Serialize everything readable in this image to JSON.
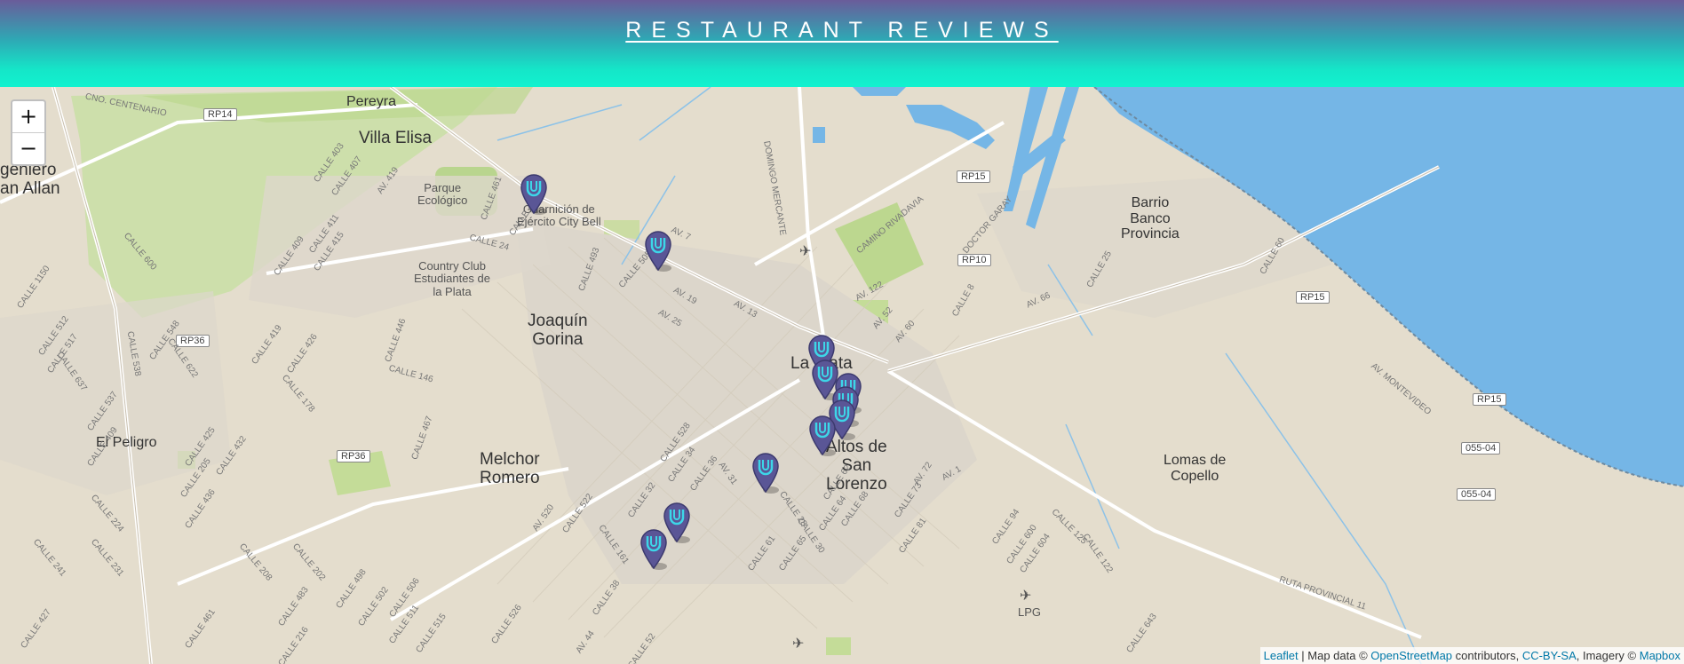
{
  "header": {
    "title": "RESTAURANT REVIEWS"
  },
  "map": {
    "zoom_in": "+",
    "zoom_out": "−",
    "attribution": {
      "leaflet": "Leaflet",
      "sep1": " | Map data © ",
      "osm": "OpenStreetMap",
      "contrib": " contributors, ",
      "license": "CC-BY-SA",
      "imagery": ", Imagery © ",
      "mapbox": "Mapbox"
    },
    "places": {
      "pereyra": "Pereyra",
      "villa_elisa": "Villa Elisa",
      "ingeniero": "geniero\nan Allan",
      "parque": "Parque\nEcológico",
      "guarnicion": "Guarnición de\nEjército City Bell",
      "country_club": "Country Club\nEstudiantes de\nla Plata",
      "joaquin": "Joaquín\nGorina",
      "la_plata": "La Plata",
      "el_peligro": "El Peligro",
      "melchor": "Melchor\nRomero",
      "altos": "Altos de\nSan\nLorenzo",
      "barrio": "Barrio\nBanco\nProvincia",
      "lomas": "Lomas de\nCopello",
      "lpg": "LPG",
      "domingo": "DOMINGO MERCANTE"
    },
    "shields": {
      "rp14": "RP14",
      "rp15a": "RP15",
      "rp10": "RP10",
      "rp15b": "RP15",
      "rp15c": "RP15",
      "rp36a": "RP36",
      "rp36b": "RP36",
      "r05504a": "055-04",
      "r05504b": "055-04"
    },
    "streets": {
      "centenario": "CNO. CENTENARIO",
      "calle403": "CALLE 403",
      "calle407": "CALLE 407",
      "av419": "AV. 419",
      "calle461": "CALLE 461",
      "calle466": "CALLE 466",
      "av7": "AV. 7",
      "calle24": "CALLE 24",
      "calle493": "CALLE 493",
      "calle505": "CALLE 505",
      "av19": "AV. 19",
      "av25": "AV. 25",
      "av13": "AV. 13",
      "av122": "AV. 122",
      "av52": "AV. 52",
      "av60": "AV. 60",
      "rivadavia": "CAMINO RIVADAVIA",
      "garay": "DOCTOR GARAY",
      "calle8": "CALLE 8",
      "av66": "AV. 66",
      "calle25": "CALLE 25",
      "calle60": "CALLE 60",
      "montevideo": "AV. MONTEVIDEO",
      "ruta11": "RUTA PROVINCIAL 11",
      "calle643": "CALLE 643",
      "calle122": "CALLE 122",
      "calle125": "CALLE 125",
      "calle94": "CALLE 94",
      "calle600": "CALLE 600",
      "calle604": "CALLE 604",
      "av1": "AV. 1",
      "av72": "AV. 72",
      "calle81": "CALLE 81",
      "calle73": "CALLE 73",
      "calle62": "CALLE 62",
      "calle68": "CALLE 68",
      "calle28": "CALLE 28",
      "calle64": "CALLE 64",
      "calle65": "CALLE 65",
      "calle61": "CALLE 61",
      "calle30": "CALLE 30",
      "av31": "AV. 31",
      "calle36": "CALLE 36",
      "calle34": "CALLE 34",
      "calle32": "CALLE 32",
      "calle528": "CALLE 528",
      "av520": "AV. 520",
      "calle522": "CALLE 522",
      "calle161": "CALLE 161",
      "calle38": "CALLE 38",
      "av44": "AV. 44",
      "calle52": "CALLE 52",
      "calle526": "CALLE 526",
      "calle515": "CALLE 515",
      "calle511": "CALLE 511",
      "calle506": "CALLE 506",
      "calle502": "CALLE 502",
      "calle498": "CALLE 498",
      "calle483": "CALLE 483",
      "calle202": "CALLE 202",
      "calle208": "CALLE 208",
      "calle216": "CALLE 216",
      "calle461b": "CALLE 461",
      "calle427": "CALLE 427",
      "calle241": "CALLE 241",
      "calle231": "CALLE 231",
      "calle224": "CALLE 224",
      "calle436": "CALLE 436",
      "calle205": "CALLE 205",
      "calle425": "CALLE 425",
      "calle432": "CALLE 432",
      "calle409": "CALLE 409",
      "calle537": "CALLE 537",
      "calle178": "CALLE 178",
      "calle467": "CALLE 467",
      "calle146": "CALLE 146",
      "calle446": "CALLE 446",
      "calle426": "CALLE 426",
      "calle419": "CALLE 419",
      "calle622": "CALLE 622",
      "calle548": "CALLE 548",
      "calle538": "CALLE 538",
      "calle512": "CALLE 512",
      "calle517": "CALLE 517",
      "calle637": "CALLE 637",
      "calle1150": "CALLE 1150",
      "calle600b": "CALLE 600",
      "calle415": "CALLE 415",
      "calle411": "CALLE 411",
      "calle409b": "CALLE 409"
    },
    "marker_count": 10
  }
}
